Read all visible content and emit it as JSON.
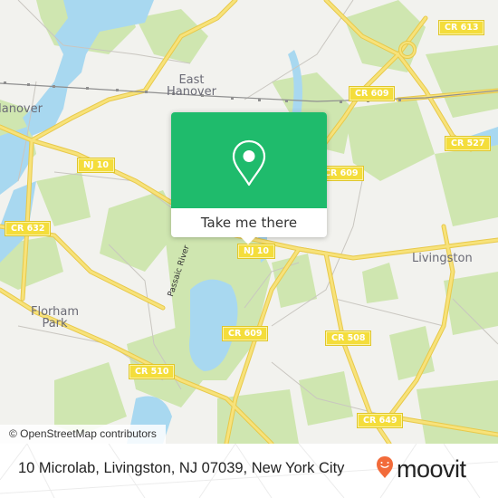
{
  "map": {
    "places": [
      {
        "name": "East Hanover",
        "lines": [
          "East",
          "Hanover"
        ]
      },
      {
        "name": "Hanover",
        "lines": [
          "Hanover"
        ]
      },
      {
        "name": "Livingston",
        "lines": [
          "Livingston"
        ]
      },
      {
        "name": "Florham Park",
        "lines": [
          "Florham",
          "Park"
        ]
      }
    ],
    "shields": [
      "CR 613",
      "CR 609",
      "CR 527",
      "NJ 10",
      "CR 632",
      "NJ 10",
      "CR 609",
      "CR 508",
      "CR 510",
      "CR 649",
      "CR 609"
    ],
    "river_label": "Passaic River",
    "attribution": "© OpenStreetMap contributors",
    "colors": {
      "land": "#f2f2ee",
      "park": "#cfe6b0",
      "water": "#a8d8f0",
      "road": "#f7e27a",
      "road_border": "#e8c94a",
      "minor_road": "#c9c6c0",
      "rail": "#8f8f8f"
    }
  },
  "popup": {
    "icon": "location-pin-icon",
    "button_label": "Take me there",
    "color": "#1fbb6c"
  },
  "footer": {
    "address": "10 Microlab, Livingston, NJ 07039, New York City",
    "brand": "moovit",
    "brand_color": "#f26b3a"
  }
}
